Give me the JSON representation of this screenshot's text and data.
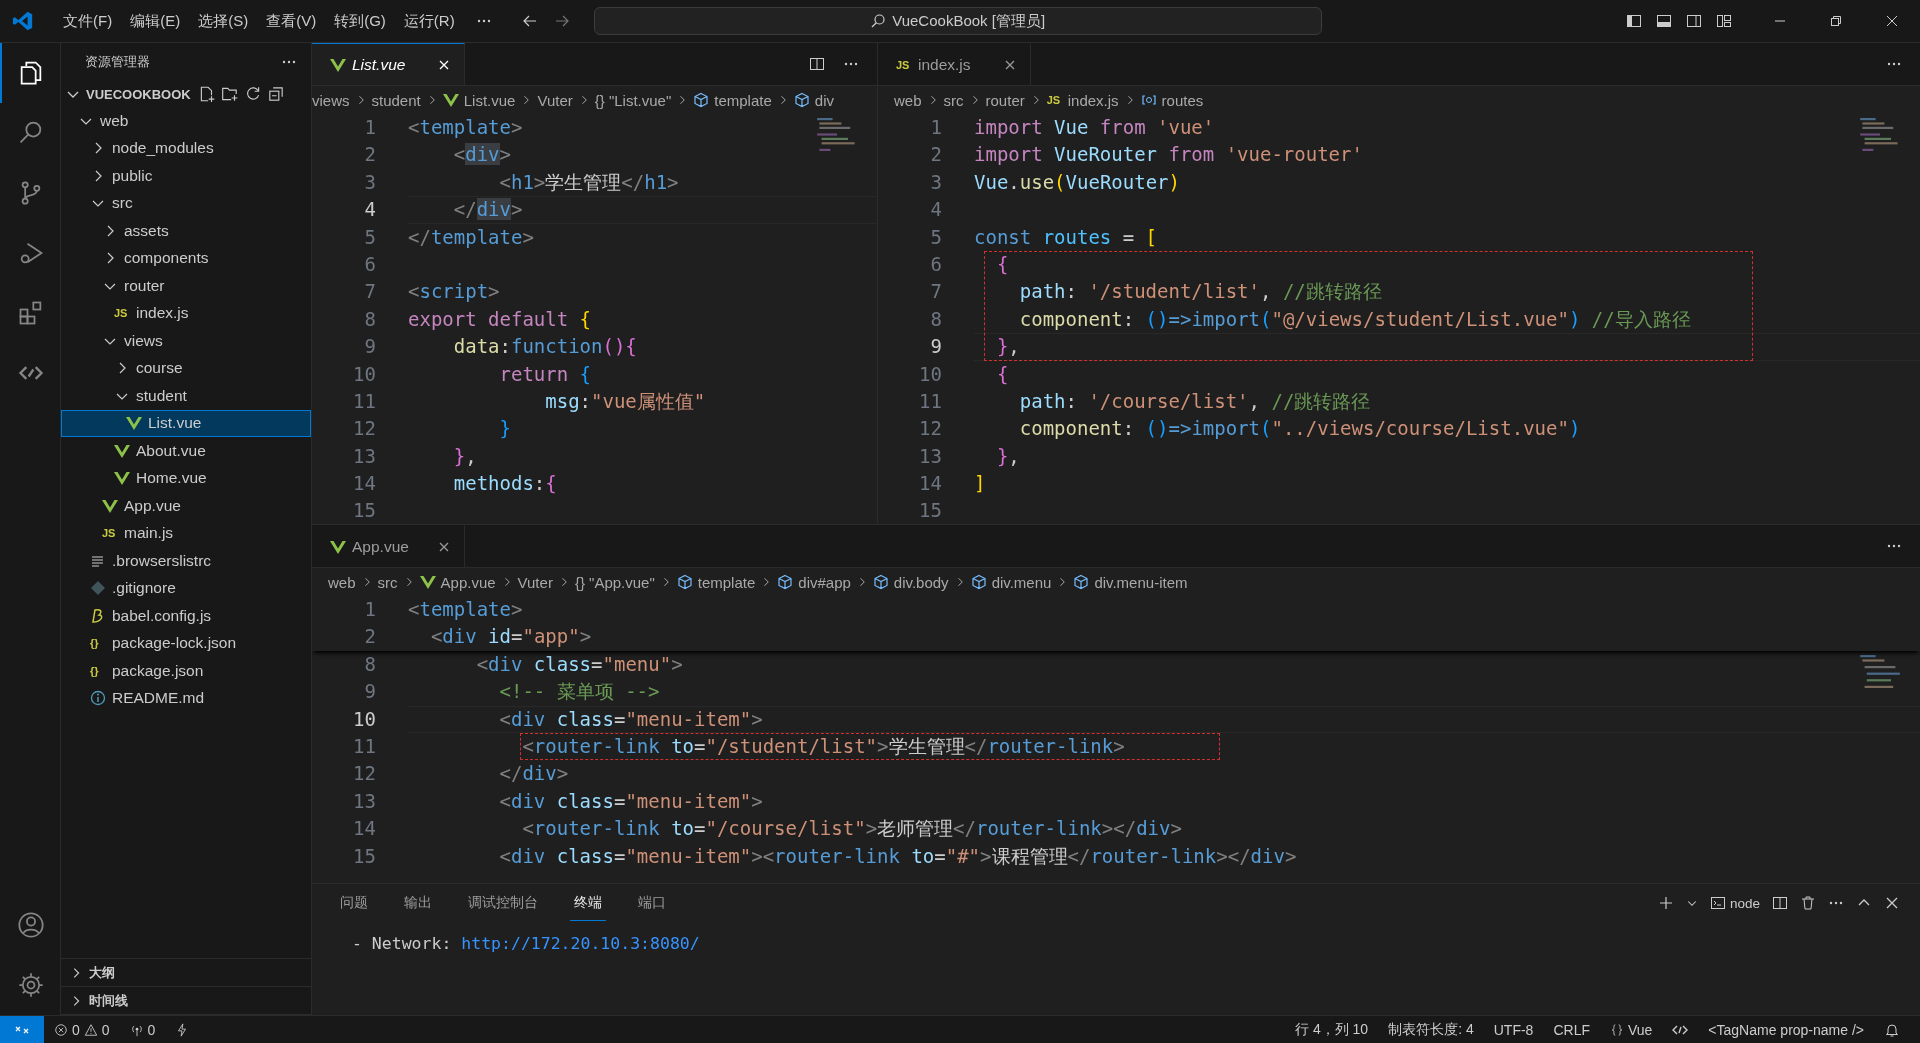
{
  "title_bar": {
    "menus": [
      "文件(F)",
      "编辑(E)",
      "选择(S)",
      "查看(V)",
      "转到(G)",
      "运行(R)"
    ],
    "search": "VueCookBook [管理员]"
  },
  "activity_bar": {
    "top": [
      {
        "kind": "explorer",
        "selected": true
      },
      {
        "kind": "search",
        "selected": false
      },
      {
        "kind": "source-control",
        "selected": false
      },
      {
        "kind": "run-debug",
        "selected": false
      },
      {
        "kind": "extensions",
        "selected": false
      },
      {
        "kind": "remote",
        "selected": false
      }
    ],
    "bottom": [
      {
        "kind": "account"
      },
      {
        "kind": "settings"
      }
    ]
  },
  "sidebar": {
    "title": "资源管理器",
    "root": "VUECOOKBOOK",
    "root_expanded": true,
    "tree": [
      {
        "label": "web",
        "kind": "folder",
        "expanded": true,
        "selected": false,
        "children": [
          {
            "label": "node_modules",
            "kind": "folder",
            "expanded": false,
            "selected": false
          },
          {
            "label": "public",
            "kind": "folder",
            "expanded": false,
            "selected": false
          },
          {
            "label": "src",
            "kind": "folder",
            "expanded": true,
            "selected": false,
            "children": [
              {
                "label": "assets",
                "kind": "folder",
                "expanded": false,
                "selected": false
              },
              {
                "label": "components",
                "kind": "folder",
                "expanded": false,
                "selected": false
              },
              {
                "label": "router",
                "kind": "folder",
                "expanded": true,
                "selected": false,
                "children": [
                  {
                    "label": "index.js",
                    "kind": "js",
                    "badge": "JS",
                    "selected": false
                  }
                ]
              },
              {
                "label": "views",
                "kind": "folder",
                "expanded": true,
                "selected": false,
                "children": [
                  {
                    "label": "course",
                    "kind": "folder",
                    "expanded": false,
                    "selected": false
                  },
                  {
                    "label": "student",
                    "kind": "folder",
                    "expanded": true,
                    "selected": false,
                    "children": [
                      {
                        "label": "List.vue",
                        "kind": "vue",
                        "selected": true
                      }
                    ]
                  },
                  {
                    "label": "About.vue",
                    "kind": "vue",
                    "selected": false
                  },
                  {
                    "label": "Home.vue",
                    "kind": "vue",
                    "selected": false
                  }
                ]
              },
              {
                "label": "App.vue",
                "kind": "vue",
                "selected": false
              },
              {
                "label": "main.js",
                "kind": "js",
                "badge": "JS",
                "selected": false
              }
            ]
          },
          {
            "label": ".browserslistrc",
            "kind": "text",
            "selected": false
          },
          {
            "label": ".gitignore",
            "kind": "git",
            "selected": false
          },
          {
            "label": "babel.config.js",
            "kind": "babel",
            "selected": false
          },
          {
            "label": "package-lock.json",
            "kind": "json",
            "badge": "{}",
            "selected": false
          },
          {
            "label": "package.json",
            "kind": "json",
            "badge": "{}",
            "selected": false
          },
          {
            "label": "README.md",
            "kind": "info",
            "selected": false
          }
        ]
      }
    ],
    "sections": [
      {
        "label": "大纲",
        "expanded": false
      },
      {
        "label": "时间线",
        "expanded": false
      }
    ]
  },
  "editors": [
    {
      "tab": {
        "label": "List.vue",
        "kind": "vue",
        "selected": true,
        "preview": true
      },
      "breadcrumbs": [
        {
          "label": "views",
          "kind": "plain"
        },
        {
          "label": "student",
          "kind": "plain"
        },
        {
          "label": "List.vue",
          "kind": "vue"
        },
        {
          "label": "Vuter",
          "kind": "plain"
        },
        {
          "label": "{} \"List.vue\"",
          "kind": "plain"
        },
        {
          "label": "template",
          "kind": "symbol"
        },
        {
          "label": "div",
          "kind": "symbol"
        }
      ],
      "lines": [
        {
          "n": "1",
          "active": false,
          "boxed": false,
          "tokens": [
            {
              "text": "<",
              "kind": "punct"
            },
            {
              "text": "template",
              "kind": "tag"
            },
            {
              "text": ">",
              "kind": "punct"
            }
          ]
        },
        {
          "n": "2",
          "active": false,
          "boxed": false,
          "tokens": [
            {
              "text": "    <",
              "kind": "punct"
            },
            {
              "text": "div",
              "kind": "tag_match"
            },
            {
              "text": ">",
              "kind": "punct"
            }
          ]
        },
        {
          "n": "3",
          "active": false,
          "boxed": false,
          "tokens": [
            {
              "text": "        <",
              "kind": "punct"
            },
            {
              "text": "h1",
              "kind": "tag"
            },
            {
              "text": ">",
              "kind": "punct"
            },
            {
              "text": "学生管理",
              "kind": "text"
            },
            {
              "text": "</",
              "kind": "punct"
            },
            {
              "text": "h1",
              "kind": "tag"
            },
            {
              "text": ">",
              "kind": "punct"
            }
          ]
        },
        {
          "n": "4",
          "active": true,
          "boxed": false,
          "tokens": [
            {
              "text": "    </",
              "kind": "punct"
            },
            {
              "text": "div",
              "kind": "tag_match"
            },
            {
              "text": ">",
              "kind": "punct"
            }
          ]
        },
        {
          "n": "5",
          "active": false,
          "boxed": false,
          "tokens": [
            {
              "text": "</",
              "kind": "punct"
            },
            {
              "text": "template",
              "kind": "tag"
            },
            {
              "text": ">",
              "kind": "punct"
            }
          ]
        },
        {
          "n": "6",
          "active": false,
          "boxed": false
        },
        {
          "n": "7",
          "active": false,
          "boxed": false,
          "tokens": [
            {
              "text": "<",
              "kind": "punct"
            },
            {
              "text": "script",
              "kind": "tag"
            },
            {
              "text": ">",
              "kind": "punct"
            }
          ]
        },
        {
          "n": "8",
          "active": false,
          "boxed": false,
          "tokens": [
            {
              "text": "export default ",
              "kind": "keyword"
            },
            {
              "text": "{",
              "kind": "bracket1"
            }
          ]
        },
        {
          "n": "9",
          "active": false,
          "boxed": false,
          "tokens": [
            {
              "text": "    data",
              "kind": "function"
            },
            {
              "text": ":",
              "kind": "text"
            },
            {
              "text": "function",
              "kind": "storage"
            },
            {
              "text": "(){",
              "kind": "bracket2"
            }
          ]
        },
        {
          "n": "10",
          "active": false,
          "boxed": false,
          "tokens": [
            {
              "text": "        return ",
              "kind": "keyword"
            },
            {
              "text": "{",
              "kind": "bracket3"
            }
          ]
        },
        {
          "n": "11",
          "active": false,
          "boxed": false,
          "tokens": [
            {
              "text": "            msg",
              "kind": "attr"
            },
            {
              "text": ":",
              "kind": "text"
            },
            {
              "text": "\"vue属性值\"",
              "kind": "string"
            }
          ]
        },
        {
          "n": "12",
          "active": false,
          "boxed": false,
          "tokens": [
            {
              "text": "        }",
              "kind": "bracket3"
            }
          ]
        },
        {
          "n": "13",
          "active": false,
          "boxed": false,
          "tokens": [
            {
              "text": "    }",
              "kind": "bracket2"
            },
            {
              "text": ",",
              "kind": "text"
            }
          ]
        },
        {
          "n": "14",
          "active": false,
          "boxed": false,
          "tokens": [
            {
              "text": "    methods",
              "kind": "attr"
            },
            {
              "text": ":",
              "kind": "text"
            },
            {
              "text": "{",
              "kind": "bracket2"
            }
          ]
        },
        {
          "n": "15",
          "active": false,
          "boxed": false
        }
      ]
    },
    {
      "tab": {
        "label": "index.js",
        "kind": "js",
        "badge": "JS",
        "selected": false,
        "preview": false
      },
      "breadcrumbs": [
        {
          "label": "web",
          "kind": "plain"
        },
        {
          "label": "src",
          "kind": "plain"
        },
        {
          "label": "router",
          "kind": "plain"
        },
        {
          "label": "index.js",
          "kind": "js",
          "badge": "JS"
        },
        {
          "label": "routes",
          "kind": "variable"
        }
      ],
      "lines": [
        {
          "n": "1",
          "active": false,
          "boxed": false,
          "tokens": [
            {
              "text": "import ",
              "kind": "keyword"
            },
            {
              "text": "Vue ",
              "kind": "variable"
            },
            {
              "text": "from ",
              "kind": "keyword"
            },
            {
              "text": "'vue'",
              "kind": "string"
            }
          ]
        },
        {
          "n": "2",
          "active": false,
          "boxed": false,
          "tokens": [
            {
              "text": "import ",
              "kind": "keyword"
            },
            {
              "text": "VueRouter ",
              "kind": "variable"
            },
            {
              "text": "from ",
              "kind": "keyword"
            },
            {
              "text": "'vue-router'",
              "kind": "string"
            }
          ]
        },
        {
          "n": "3",
          "active": false,
          "boxed": false,
          "tokens": [
            {
              "text": "Vue",
              "kind": "variable"
            },
            {
              "text": ".",
              "kind": "text"
            },
            {
              "text": "use",
              "kind": "function"
            },
            {
              "text": "(",
              "kind": "bracket1"
            },
            {
              "text": "VueRouter",
              "kind": "variable"
            },
            {
              "text": ")",
              "kind": "bracket1"
            }
          ]
        },
        {
          "n": "4",
          "active": false,
          "boxed": false
        },
        {
          "n": "5",
          "active": false,
          "boxed": false,
          "tokens": [
            {
              "text": "const ",
              "kind": "storage"
            },
            {
              "text": "routes",
              "kind": "constant"
            },
            {
              "text": " = ",
              "kind": "text"
            },
            {
              "text": "[",
              "kind": "bracket1"
            }
          ]
        },
        {
          "n": "6",
          "active": false,
          "boxed": true,
          "tokens": [
            {
              "text": "  {",
              "kind": "bracket2"
            }
          ]
        },
        {
          "n": "7",
          "active": false,
          "boxed": true,
          "tokens": [
            {
              "text": "    path",
              "kind": "attr"
            },
            {
              "text": ": ",
              "kind": "text"
            },
            {
              "text": "'/student/list'",
              "kind": "string"
            },
            {
              "text": ", ",
              "kind": "text"
            },
            {
              "text": "//跳转路径",
              "kind": "comment"
            }
          ]
        },
        {
          "n": "8",
          "active": false,
          "boxed": true,
          "tokens": [
            {
              "text": "    component",
              "kind": "function"
            },
            {
              "text": ": ",
              "kind": "text"
            },
            {
              "text": "()",
              "kind": "bracket3"
            },
            {
              "text": "=>import",
              "kind": "storage"
            },
            {
              "text": "(",
              "kind": "bracket3"
            },
            {
              "text": "\"@/views/student/List.vue\"",
              "kind": "string"
            },
            {
              "text": ")",
              "kind": "bracket3"
            },
            {
              "text": " //导入路径",
              "kind": "comment"
            }
          ]
        },
        {
          "n": "9",
          "active": true,
          "boxed": true,
          "tokens": [
            {
              "text": "  }",
              "kind": "bracket2"
            },
            {
              "text": ",",
              "kind": "text"
            }
          ]
        },
        {
          "n": "10",
          "active": false,
          "boxed": false,
          "tokens": [
            {
              "text": "  {",
              "kind": "bracket2"
            }
          ]
        },
        {
          "n": "11",
          "active": false,
          "boxed": false,
          "tokens": [
            {
              "text": "    path",
              "kind": "attr"
            },
            {
              "text": ": ",
              "kind": "text"
            },
            {
              "text": "'/course/list'",
              "kind": "string"
            },
            {
              "text": ", ",
              "kind": "text"
            },
            {
              "text": "//跳转路径",
              "kind": "comment"
            }
          ]
        },
        {
          "n": "12",
          "active": false,
          "boxed": false,
          "tokens": [
            {
              "text": "    component",
              "kind": "function"
            },
            {
              "text": ": ",
              "kind": "text"
            },
            {
              "text": "()",
              "kind": "bracket3"
            },
            {
              "text": "=>import",
              "kind": "storage"
            },
            {
              "text": "(",
              "kind": "bracket3"
            },
            {
              "text": "\"../views/course/List.vue\"",
              "kind": "string"
            },
            {
              "text": ")",
              "kind": "bracket3"
            }
          ]
        },
        {
          "n": "13",
          "active": false,
          "boxed": false,
          "tokens": [
            {
              "text": "  }",
              "kind": "bracket2"
            },
            {
              "text": ",",
              "kind": "text"
            }
          ]
        },
        {
          "n": "14",
          "active": false,
          "boxed": false,
          "tokens": [
            {
              "text": "]",
              "kind": "bracket1"
            }
          ]
        },
        {
          "n": "15",
          "active": false,
          "boxed": false
        }
      ]
    },
    {
      "tab": {
        "label": "App.vue",
        "kind": "vue",
        "selected": false,
        "preview": false
      },
      "breadcrumbs": [
        {
          "label": "web",
          "kind": "plain"
        },
        {
          "label": "src",
          "kind": "plain"
        },
        {
          "label": "App.vue",
          "kind": "vue"
        },
        {
          "label": "Vuter",
          "kind": "plain"
        },
        {
          "label": "{} \"App.vue\"",
          "kind": "plain"
        },
        {
          "label": "template",
          "kind": "symbol"
        },
        {
          "label": "div#app",
          "kind": "symbol"
        },
        {
          "label": "div.body",
          "kind": "symbol"
        },
        {
          "label": "div.menu",
          "kind": "symbol"
        },
        {
          "label": "div.menu-item",
          "kind": "symbol"
        }
      ],
      "sticky_lines": [
        {
          "n": "1",
          "tokens": [
            {
              "text": "<",
              "kind": "punct"
            },
            {
              "text": "template",
              "kind": "tag"
            },
            {
              "text": ">",
              "kind": "punct"
            }
          ]
        },
        {
          "n": "2",
          "tokens": [
            {
              "text": "  <",
              "kind": "punct"
            },
            {
              "text": "div ",
              "kind": "tag"
            },
            {
              "text": "id",
              "kind": "attr"
            },
            {
              "text": "=",
              "kind": "text"
            },
            {
              "text": "\"app\"",
              "kind": "string"
            },
            {
              "text": ">",
              "kind": "punct"
            }
          ]
        }
      ],
      "lines": [
        {
          "n": "8",
          "active": false,
          "boxed": false,
          "tokens": [
            {
              "text": "      <",
              "kind": "punct"
            },
            {
              "text": "div ",
              "kind": "tag"
            },
            {
              "text": "class",
              "kind": "attr"
            },
            {
              "text": "=",
              "kind": "text"
            },
            {
              "text": "\"menu\"",
              "kind": "string"
            },
            {
              "text": ">",
              "kind": "punct"
            }
          ]
        },
        {
          "n": "9",
          "active": false,
          "boxed": false,
          "tokens": [
            {
              "text": "        <!-- 菜单项 -->",
              "kind": "comment"
            }
          ]
        },
        {
          "n": "10",
          "active": true,
          "boxed": false,
          "tokens": [
            {
              "text": "        <",
              "kind": "punct"
            },
            {
              "text": "div ",
              "kind": "tag"
            },
            {
              "text": "class",
              "kind": "attr"
            },
            {
              "text": "=",
              "kind": "text"
            },
            {
              "text": "\"menu-item\"",
              "kind": "string"
            },
            {
              "text": ">",
              "kind": "punct"
            }
          ]
        },
        {
          "n": "11",
          "active": false,
          "boxed": true,
          "tokens": [
            {
              "text": "          <",
              "kind": "punct"
            },
            {
              "text": "router-link ",
              "kind": "tag"
            },
            {
              "text": "to",
              "kind": "attr"
            },
            {
              "text": "=",
              "kind": "text"
            },
            {
              "text": "\"/student/list\"",
              "kind": "string"
            },
            {
              "text": ">",
              "kind": "punct"
            },
            {
              "text": "学生管理",
              "kind": "text"
            },
            {
              "text": "</",
              "kind": "punct"
            },
            {
              "text": "router-link",
              "kind": "tag"
            },
            {
              "text": ">",
              "kind": "punct"
            }
          ]
        },
        {
          "n": "12",
          "active": false,
          "boxed": false,
          "tokens": [
            {
              "text": "        </",
              "kind": "punct"
            },
            {
              "text": "div",
              "kind": "tag"
            },
            {
              "text": ">",
              "kind": "punct"
            }
          ]
        },
        {
          "n": "13",
          "active": false,
          "boxed": false,
          "tokens": [
            {
              "text": "        <",
              "kind": "punct"
            },
            {
              "text": "div ",
              "kind": "tag"
            },
            {
              "text": "class",
              "kind": "attr"
            },
            {
              "text": "=",
              "kind": "text"
            },
            {
              "text": "\"menu-item\"",
              "kind": "string"
            },
            {
              "text": ">",
              "kind": "punct"
            }
          ]
        },
        {
          "n": "14",
          "active": false,
          "boxed": false,
          "tokens": [
            {
              "text": "          <",
              "kind": "punct"
            },
            {
              "text": "router-link ",
              "kind": "tag"
            },
            {
              "text": "to",
              "kind": "attr"
            },
            {
              "text": "=",
              "kind": "text"
            },
            {
              "text": "\"/course/list\"",
              "kind": "string"
            },
            {
              "text": ">",
              "kind": "punct"
            },
            {
              "text": "老师管理",
              "kind": "text"
            },
            {
              "text": "</",
              "kind": "punct"
            },
            {
              "text": "router-link",
              "kind": "tag"
            },
            {
              "text": "></",
              "kind": "punct"
            },
            {
              "text": "div",
              "kind": "tag"
            },
            {
              "text": ">",
              "kind": "punct"
            }
          ]
        },
        {
          "n": "15",
          "active": false,
          "boxed": false,
          "tokens": [
            {
              "text": "        <",
              "kind": "punct"
            },
            {
              "text": "div ",
              "kind": "tag"
            },
            {
              "text": "class",
              "kind": "attr"
            },
            {
              "text": "=",
              "kind": "text"
            },
            {
              "text": "\"menu-item\"",
              "kind": "string"
            },
            {
              "text": "><",
              "kind": "punct"
            },
            {
              "text": "router-link ",
              "kind": "tag"
            },
            {
              "text": "to",
              "kind": "attr"
            },
            {
              "text": "=",
              "kind": "text"
            },
            {
              "text": "\"#\"",
              "kind": "string"
            },
            {
              "text": ">",
              "kind": "punct"
            },
            {
              "text": "课程管理",
              "kind": "text"
            },
            {
              "text": "</",
              "kind": "punct"
            },
            {
              "text": "router-link",
              "kind": "tag"
            },
            {
              "text": "></",
              "kind": "punct"
            },
            {
              "text": "div",
              "kind": "tag"
            },
            {
              "text": ">",
              "kind": "punct"
            }
          ]
        }
      ]
    }
  ],
  "panel": {
    "tabs": [
      {
        "label": "问题",
        "selected": false
      },
      {
        "label": "输出",
        "selected": false
      },
      {
        "label": "调试控制台",
        "selected": false
      },
      {
        "label": "终端",
        "selected": true
      },
      {
        "label": "端口",
        "selected": false
      }
    ],
    "terminal_name": "node",
    "output": {
      "prefix": "- Network: ",
      "link": "http://172.20.10.3:8080/"
    }
  },
  "status_bar": {
    "errors": "0",
    "warnings": "0",
    "ports": "0",
    "position": "行 4，列 10",
    "indent": "制表符长度: 4",
    "encoding": "UTF-8",
    "eol": "CRLF",
    "language": "Vue",
    "tag_hint": "<TagName prop-name />"
  }
}
